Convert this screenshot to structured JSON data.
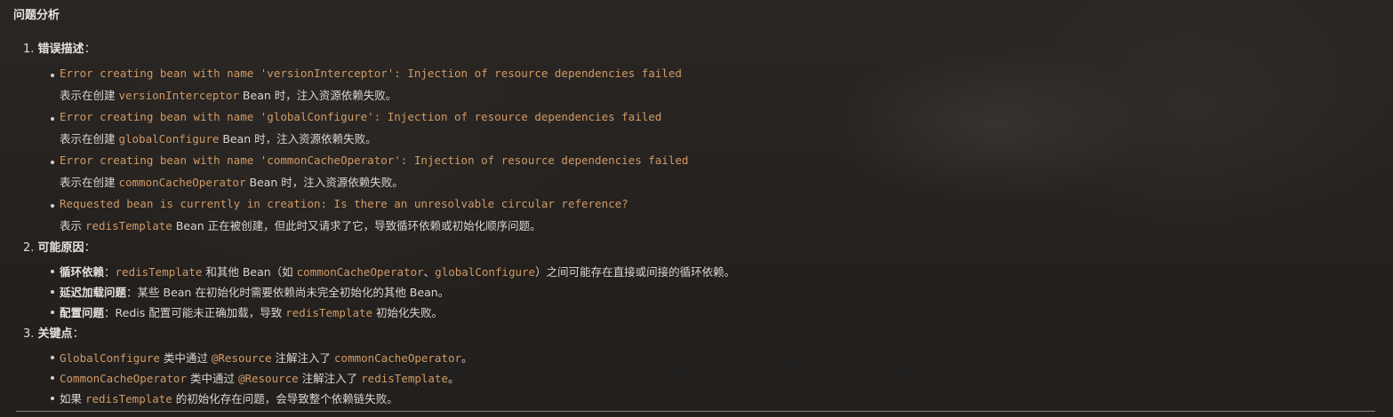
{
  "title": "问题分析",
  "sections": [
    {
      "num": "1.",
      "label": "错误描述",
      "colon": "：",
      "items": [
        {
          "code": "Error creating bean with name 'versionInterceptor': Injection of resource dependencies failed",
          "desc_prefix": "表示在创建 ",
          "desc_code": "versionInterceptor",
          "desc_suffix": " Bean 时，注入资源依赖失败。"
        },
        {
          "code": "Error creating bean with name 'globalConfigure': Injection of resource dependencies failed",
          "desc_prefix": "表示在创建 ",
          "desc_code": "globalConfigure",
          "desc_suffix": " Bean 时，注入资源依赖失败。"
        },
        {
          "code": "Error creating bean with name 'commonCacheOperator': Injection of resource dependencies failed",
          "desc_prefix": "表示在创建 ",
          "desc_code": "commonCacheOperator",
          "desc_suffix": " Bean 时，注入资源依赖失败。"
        },
        {
          "code": "Requested bean is currently in creation: Is there an unresolvable circular reference?",
          "desc_prefix": "表示 ",
          "desc_code": "redisTemplate",
          "desc_suffix": " Bean 正在被创建，但此时又请求了它，导致循环依赖或初始化顺序问题。"
        }
      ]
    },
    {
      "num": "2.",
      "label": "可能原因",
      "colon": "：",
      "items": [
        {
          "bold": "循环依赖",
          "sep": "：",
          "code1": "redisTemplate",
          "text1": " 和其他 Bean（如 ",
          "code2": "commonCacheOperator",
          "text2": "、",
          "code3": "globalConfigure",
          "text3": "）之间可能存在直接或间接的循环依赖。"
        },
        {
          "bold": "延迟加载问题",
          "sep": "：",
          "text": "某些 Bean 在初始化时需要依赖尚未完全初始化的其他 Bean。"
        },
        {
          "bold": "配置问题",
          "sep": "：",
          "text1": "Redis 配置可能未正确加载，导致 ",
          "code": "redisTemplate",
          "text2": " 初始化失败。"
        }
      ]
    },
    {
      "num": "3.",
      "label": "关键点",
      "colon": "：",
      "items": [
        {
          "code1": "GlobalConfigure",
          "text1": " 类中通过 ",
          "code2": "@Resource",
          "text2": " 注解注入了 ",
          "code3": "commonCacheOperator",
          "text3": "。"
        },
        {
          "code1": "CommonCacheOperator",
          "text1": " 类中通过 ",
          "code2": "@Resource",
          "text2": " 注解注入了 ",
          "code3": "redisTemplate",
          "text3": "。"
        },
        {
          "text1": "如果 ",
          "code": "redisTemplate",
          "text2": " 的初始化存在问题，会导致整个依赖链失败。"
        }
      ]
    }
  ],
  "colors": {
    "code": "#d19a66",
    "text": "#dcd6d0",
    "background": "#262320"
  }
}
